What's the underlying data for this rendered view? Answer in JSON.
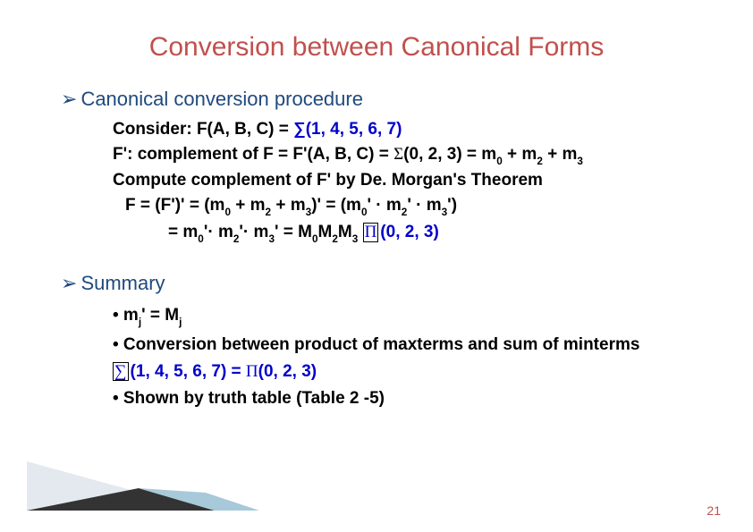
{
  "title": "Conversion between Canonical Forms",
  "section1": {
    "heading": "Canonical conversion procedure",
    "line1_a": "Consider: F(A, B, C) = ",
    "line1_b": "∑",
    "line1_c": "(1, 4, 5, 6, 7)",
    "line2_a": "F': complement of F = F'(A, B, C) =  ",
    "line2_sigma": "Σ",
    "line2_b": "(0, 2, 3) = m",
    "line2_s0": "0",
    "line2_c": " + m",
    "line2_s2": "2",
    "line2_d": " + m",
    "line2_s3": "3",
    "line3": "Compute complement of F' by De. Morgan's Theorem",
    "line4_a": "F = (F')' = (m",
    "line4_s0": "0",
    "line4_b": " + m",
    "line4_s2": "2",
    "line4_c": " + m",
    "line4_s3": "3",
    "line4_d": ")' = (m",
    "line4_s0b": "0",
    "line4_e": "'  ·  m",
    "line4_s2b": "2",
    "line4_f": "'  ·  m",
    "line4_s3b": "3",
    "line4_g": "')",
    "line5_a": "= m",
    "line5_s0": "0",
    "line5_b": "'· m",
    "line5_s2": "2",
    "line5_c": "'· m",
    "line5_s3": "3",
    "line5_d": "' = M",
    "line5_M0": "0",
    "line5_e": "M",
    "line5_M2": "2",
    "line5_f": "M",
    "line5_M3": "3",
    "line5_g": "   ",
    "line5_pi": "Π",
    "line5_blue": "(0, 2, 3)"
  },
  "section2": {
    "heading": "Summary",
    "bullet1_a": "• m",
    "bullet1_sj1": "j",
    "bullet1_b": "' = M",
    "bullet1_sj2": "j",
    "bullet2": "• Conversion between product of maxterms and sum of minterms",
    "bullet3_sum": "∑",
    "bullet3_a": "(1, 4, 5, 6, 7) =    ",
    "bullet3_pi": "Π",
    "bullet3_b": "(0, 2, 3)",
    "bullet4": "• Shown by truth table (Table 2 -5)"
  },
  "page": "21"
}
